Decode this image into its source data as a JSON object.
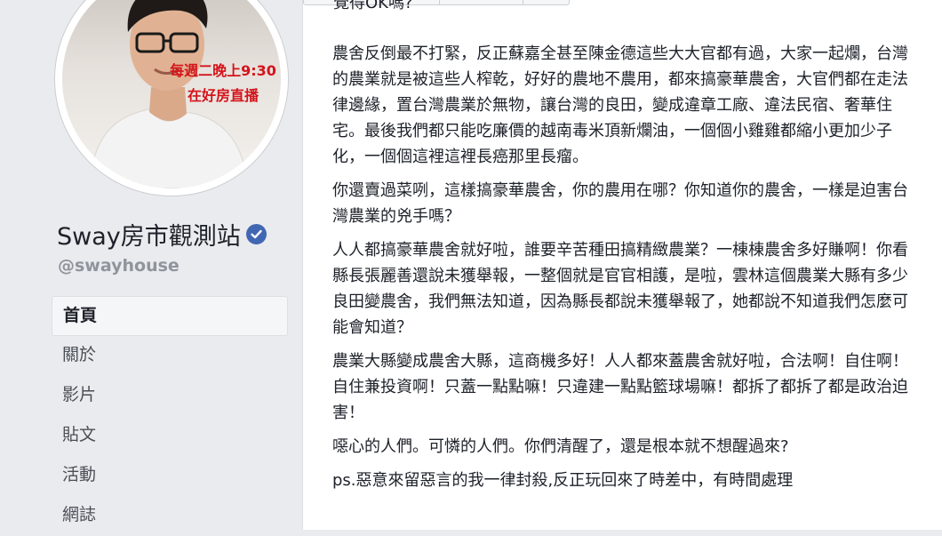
{
  "sidebar": {
    "avatar_promo": [
      "每週二晚上9:30",
      "在好房直播"
    ],
    "page_name": "Sway房市觀測站",
    "handle": "@swayhouse",
    "nav": [
      {
        "label": "首頁",
        "active": true
      },
      {
        "label": "關於",
        "active": false
      },
      {
        "label": "影片",
        "active": false
      },
      {
        "label": "貼文",
        "active": false
      },
      {
        "label": "活動",
        "active": false
      },
      {
        "label": "網誌",
        "active": false
      }
    ]
  },
  "post": {
    "cut_line": "覺得OK嗎?",
    "paragraphs": [
      "農舍反倒最不打緊，反正蘇嘉全甚至陳金德這些大大官都有過，大家一起爛，台灣的農業就是被這些人榨乾，好好的農地不農用，都來搞豪華農舍，大官們都在走法律邊緣，置台灣農業於無物，讓台灣的良田，變成違章工廠、違法民宿、奢華住宅。最後我們都只能吃廉價的越南毒米頂新爛油，一個個小雞雞都縮小更加少子化，一個個這裡這裡長癌那里長瘤。",
      "你還賣過菜咧，這樣搞豪華農舍，你的農用在哪？你知道你的農舍，一樣是迫害台灣農業的兇手嗎？",
      "人人都搞豪華農舍就好啦，誰要辛苦種田搞精緻農業？一棟棟農舍多好賺啊！你看縣長張麗善還說未獲舉報，一整個就是官官相護，是啦，雲林這個農業大縣有多少良田變農舍，我們無法知道，因為縣長都說未獲舉報了，她都說不知道我們怎麼可能會知道？",
      "農業大縣變成農舍大縣，這商機多好！人人都來蓋農舍就好啦，合法啊！自住啊！自住兼投資啊！只蓋一點點嘛！只違建一點點籃球場嘛！都拆了都拆了都是政治迫害！",
      "噁心的人們。可憐的人們。你們清醒了，還是根本就不想醒過來?",
      "ps.惡意來留惡言的我一律封殺,反正玩回來了時差中，有時間處理"
    ]
  },
  "colors": {
    "fb_blue": "#4267b2",
    "promo_red": "#d4141b",
    "page_bg": "#e9ebee",
    "text": "#1d2129",
    "muted": "#90949c"
  },
  "icons": {
    "verified": "verified-check-icon"
  }
}
